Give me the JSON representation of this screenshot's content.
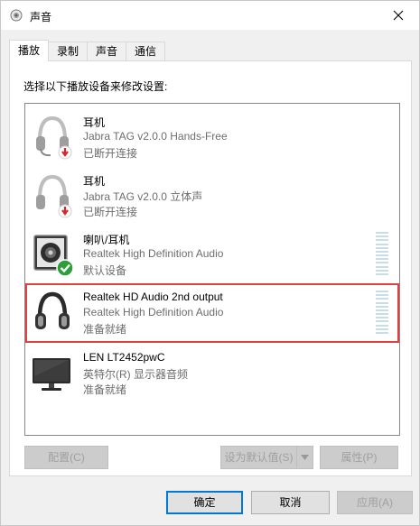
{
  "window": {
    "title": "声音",
    "close_label": "×"
  },
  "tabs": [
    {
      "label": "播放",
      "active": true
    },
    {
      "label": "录制",
      "active": false
    },
    {
      "label": "声音",
      "active": false
    },
    {
      "label": "通信",
      "active": false
    }
  ],
  "instruction": "选择以下播放设备来修改设置:",
  "devices": [
    {
      "name": "耳机",
      "description": "Jabra TAG v2.0.0 Hands-Free",
      "status": "已断开连接",
      "icon": "headset-disconnected-icon"
    },
    {
      "name": "耳机",
      "description": "Jabra TAG v2.0.0 立体声",
      "status": "已断开连接",
      "icon": "headphones-disconnected-icon"
    },
    {
      "name": "喇叭/耳机",
      "description": "Realtek High Definition Audio",
      "status": "默认设备",
      "icon": "speaker-default-icon"
    },
    {
      "name": "Realtek HD Audio 2nd output",
      "description": "Realtek High Definition Audio",
      "status": "准备就绪",
      "icon": "headphones-icon",
      "selected": true
    },
    {
      "name": "LEN LT2452pwC",
      "description": "英特尔(R) 显示器音频",
      "status": "准备就绪",
      "icon": "monitor-icon"
    }
  ],
  "buttons": {
    "configure": "配置(C)",
    "set_default": "设为默认值(S)",
    "properties": "属性(P)",
    "ok": "确定",
    "cancel": "取消",
    "apply": "应用(A)"
  },
  "colors": {
    "selection_border": "#e04040",
    "default_check": "#2e9e3a",
    "disconnect_arrow": "#d9262a",
    "accent": "#0078d7"
  }
}
